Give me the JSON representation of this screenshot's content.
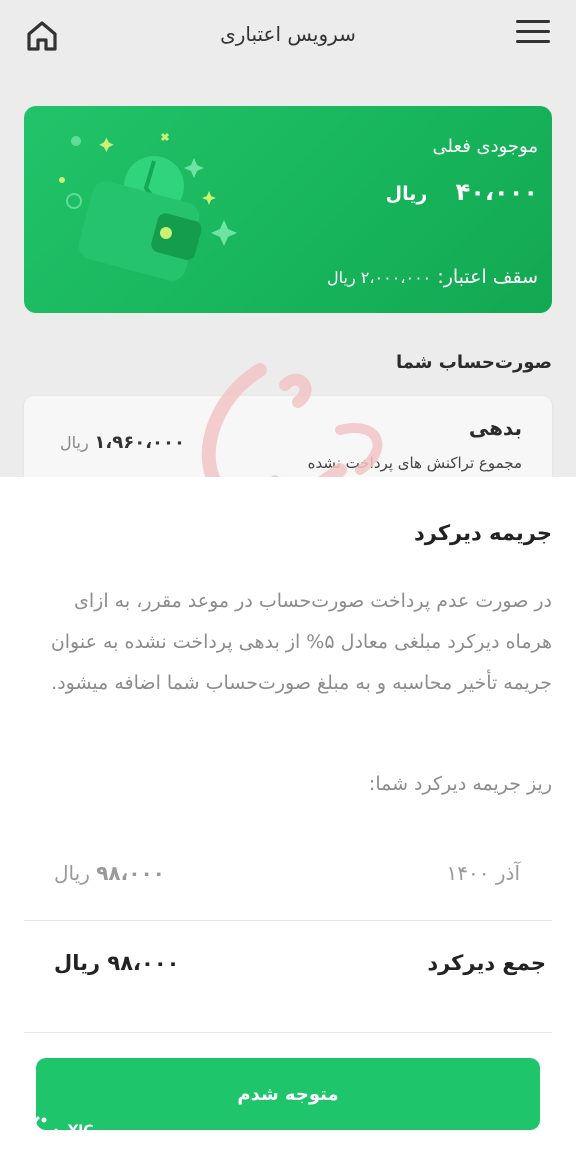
{
  "header": {
    "title": "سرویس اعتباری"
  },
  "wallet": {
    "balance_label": "موجودی فعلی",
    "balance_value": "۴۰،۰۰۰",
    "balance_unit": "ریال",
    "limit_label": "سقف اعتبار:",
    "limit_value": "۲،۰۰۰،۰۰۰ ریال"
  },
  "statement": {
    "section_title": "صورت‌حساب شما",
    "debt_title": "بدهی",
    "debt_subtitle": "مجموع تراکنش های پرداخت نشده",
    "debt_value": "۱،۹۶۰،۰۰۰",
    "debt_unit": "ریال"
  },
  "sheet": {
    "title": "جریمه دیرکرد",
    "description": "در صورت عدم پرداخت صورت‌حساب در موعد مقرر، به ازای هرماه دیرکرد مبلغی معادل ۵% از بدهی پرداخت نشده به عنوان جریمه تأخیر محاسبه و به مبلغ صورت‌حساب شما اضافه میشود.",
    "breakdown_label": "ریز جریمه دیرکرد شما:",
    "rows": [
      {
        "label": "آذر ۱۴۰۰",
        "value": "۹۸،۰۰۰",
        "unit": "ریال"
      }
    ],
    "total_label": "جمع دیرکرد",
    "total_value": "۹۸،۰۰۰",
    "total_unit": "ریال",
    "ok_button": "متوجه شدم"
  },
  "watermark_logo": {
    "text": "YJC"
  },
  "colors": {
    "accent": "#1fc56b",
    "card": "#17b45b",
    "background": "#ececec"
  }
}
